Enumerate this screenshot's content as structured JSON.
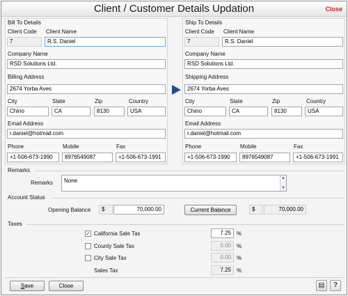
{
  "window": {
    "title": "Client / Customer Details Updation",
    "close_label": "Close"
  },
  "bill_to": {
    "title": "Bill To Details",
    "client_code_label": "Client Code",
    "client_code": "7",
    "client_name_label": "Client Name",
    "client_name": "R.S. Daniel",
    "company_name_label": "Company Name",
    "company_name": "RSD Solutions Ltd.",
    "address_label": "Billing Address",
    "address": "2674 Yorba Aves",
    "city_label": "City",
    "city": "Chino",
    "state_label": "State",
    "state": "CA",
    "zip_label": "Zip",
    "zip": "8130",
    "country_label": "Country",
    "country": "USA",
    "email_label": "Email Address",
    "email": "r.daniel@hotmail.com",
    "phone_label": "Phone",
    "phone": "+1-506-673-1990",
    "mobile_label": "Mobile",
    "mobile": "8976549087",
    "fax_label": "Fax",
    "fax": "+1-506-673-1991"
  },
  "ship_to": {
    "title": "Ship To Details",
    "client_code_label": "Client Code",
    "client_code": "7",
    "client_name_label": "Client Name",
    "client_name": "R.S. Daniel",
    "company_name_label": "Company Name",
    "company_name": "RSD Solutions Ltd.",
    "address_label": "Shipping Address",
    "address": "2674 Yorba Aves",
    "city_label": "City",
    "city": "Chino",
    "state_label": "State",
    "state": "CA",
    "zip_label": "Zip",
    "zip": "8130",
    "country_label": "Country",
    "country": "USA",
    "email_label": "Email Address",
    "email": "r.daniel@hotmail.com",
    "phone_label": "Phone",
    "phone": "+1-506-673-1990",
    "mobile_label": "Mobile",
    "mobile": "8976549087",
    "fax_label": "Fax",
    "fax": "+1-506-673-1991"
  },
  "remarks": {
    "section_title": "Remarks",
    "label": "Remarks",
    "value": "None"
  },
  "account_status": {
    "section_title": "Account Status",
    "opening_balance_label": "Opening Balance",
    "currency": "$",
    "opening_balance": "70,000.00",
    "current_balance_button": "Current Balance",
    "current_balance": "70,000.00"
  },
  "taxes": {
    "section_title": "Taxes",
    "items": [
      {
        "label": "California Sale Tax",
        "checked": true,
        "value": "7.25",
        "unit": "%"
      },
      {
        "label": "County Sale Tax",
        "checked": false,
        "value": "0.00",
        "unit": "%"
      },
      {
        "label": "City Sale Tax",
        "checked": false,
        "value": "0.00",
        "unit": "%"
      }
    ],
    "sales_tax_label": "Sales Tax",
    "sales_tax": "7.25",
    "sales_tax_unit": "%"
  },
  "footer": {
    "save_label": "Save",
    "close_label": "Close",
    "save_accel": "S",
    "save_rest": "ave"
  },
  "icons": {
    "copy_arrow": "right-arrow-icon",
    "printer": "printer-icon",
    "help": "help-icon"
  },
  "colors": {
    "close": "#c62020",
    "arrow": "#1f4e8c"
  }
}
